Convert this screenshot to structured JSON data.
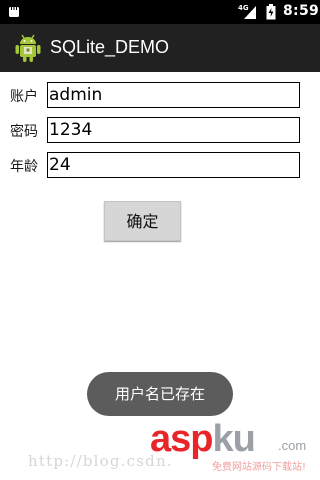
{
  "status_bar": {
    "time": "8:59",
    "network_type": "4G",
    "icons": [
      "notification-icon",
      "signal-icon",
      "battery-icon"
    ]
  },
  "action_bar": {
    "title": "SQLite_DEMO",
    "app_icon": "android-icon",
    "background": "#212121"
  },
  "form": {
    "fields": [
      {
        "label": "账户",
        "value": "admin"
      },
      {
        "label": "密码",
        "value": "1234"
      },
      {
        "label": "年龄",
        "value": "24"
      }
    ],
    "submit_label": "确定"
  },
  "toast": {
    "message": "用户名已存在"
  },
  "watermark": {
    "url": "http://blog.csdn.",
    "logo_asp": "asp",
    "logo_ku": "ku",
    "logo_com": ".com",
    "tagline": "免费网站源码下载站!"
  },
  "colors": {
    "status_bar": "#000000",
    "toast": "#5c5c5c",
    "button": "#d6d6d6",
    "watermark_red": "#e8262a"
  }
}
